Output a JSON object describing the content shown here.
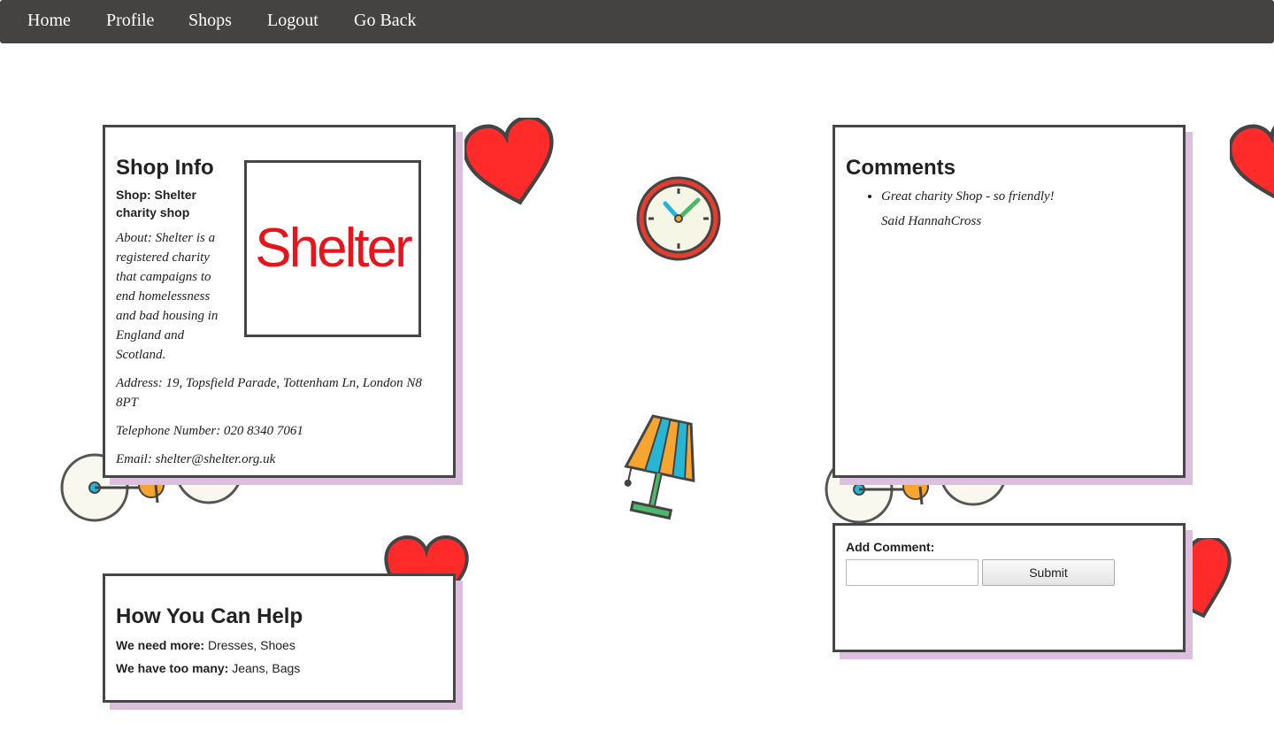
{
  "nav": {
    "items": [
      "Home",
      "Profile",
      "Shops",
      "Logout",
      "Go Back"
    ]
  },
  "shop_info": {
    "heading": "Shop Info",
    "shop_name": "Shop: Shelter charity shop",
    "about": "About: Shelter is a registered charity that campaigns to end homelessness and bad housing in England and Scotland.",
    "address": "Address: 19, Topsfield Parade, Tottenham Ln, London N8 8PT",
    "telephone": "Telephone Number: 020 8340 7061",
    "email": "Email: shelter@shelter.org.uk",
    "logo_text": "Shelter"
  },
  "comments": {
    "heading": "Comments",
    "items": [
      {
        "text": "Great charity Shop - so friendly!",
        "author": "Said HannahCross"
      }
    ]
  },
  "add_comment": {
    "label": "Add Comment:",
    "input_placeholder": "",
    "submit_label": "Submit"
  },
  "help": {
    "heading": "How You Can Help",
    "need_more_label": "We need more:",
    "need_more_value": " Dresses, Shoes",
    "too_many_label": "We have too many:",
    "too_many_value": " Jeans, Bags"
  },
  "colors": {
    "nav_bg": "#444342",
    "panel_border": "#464646",
    "panel_shadow": "#dcbfdc",
    "logo_red": "#e8141c",
    "heart_red": "#ff2a2a"
  },
  "icons": [
    "heart-icon",
    "clock-icon",
    "lamp-icon",
    "bicycle-icon"
  ]
}
